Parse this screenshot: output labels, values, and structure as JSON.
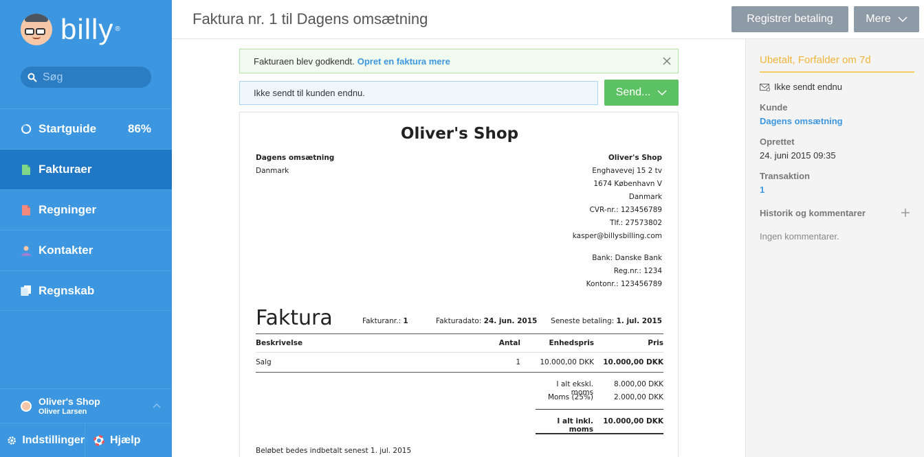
{
  "sidebar": {
    "logo_text": "billy",
    "logo_reg": "®",
    "search_placeholder": "Søg",
    "items": [
      {
        "label": "Startguide",
        "badge": "86%"
      },
      {
        "label": "Fakturaer"
      },
      {
        "label": "Regninger"
      },
      {
        "label": "Kontakter"
      },
      {
        "label": "Regnskab"
      }
    ],
    "user": {
      "org": "Oliver's Shop",
      "name": "Oliver Larsen"
    },
    "settings_label": "Indstillinger",
    "help_label": "Hjælp"
  },
  "topbar": {
    "title": "Faktura nr. 1 til Dagens omsætning",
    "register_label": "Registrer betaling",
    "more_label": "Mere"
  },
  "alerts": {
    "success_text": "Fakturaen blev godkendt.",
    "success_link": "Opret en faktura mere",
    "info_text": "Ikke sendt til kunden endnu.",
    "send_label": "Send..."
  },
  "invoice": {
    "shop_name": "Oliver's Shop",
    "to": {
      "name": "Dagens omsætning",
      "country": "Danmark"
    },
    "from": {
      "name": "Oliver's Shop",
      "street": "Enghavevej 15 2 tv",
      "city": "1674 København V",
      "country": "Danmark",
      "cvr": "CVR-nr.: 123456789",
      "phone": "Tlf.: 27573802",
      "email": "kasper@billysbilling.com"
    },
    "bank": {
      "bank": "Bank: Danske Bank",
      "reg": "Reg.nr.: 1234",
      "account": "Kontonr.: 123456789"
    },
    "heading": "Faktura",
    "meta": {
      "number_label": "Fakturanr.:",
      "number": "1",
      "date_label": "Fakturadato:",
      "date": "24. jun. 2015",
      "due_label": "Seneste betaling:",
      "due": "1. jul. 2015"
    },
    "columns": {
      "desc": "Beskrivelse",
      "qty": "Antal",
      "unit": "Enhedspris",
      "price": "Pris"
    },
    "lines": [
      {
        "desc": "Salg",
        "qty": "1",
        "unit": "10.000,00 DKK",
        "price": "10.000,00 DKK"
      }
    ],
    "totals": {
      "excl_label": "I alt ekskl. moms",
      "excl": "8.000,00 DKK",
      "vat_label": "Moms (25%)",
      "vat": "2.000,00 DKK",
      "incl_label": "I alt inkl. moms",
      "incl": "10.000,00 DKK"
    },
    "note": "Beløbet bedes indbetalt senest 1. jul. 2015"
  },
  "panel": {
    "status": "Ubetalt, Forfalder om 7d",
    "sent_status": "Ikke sendt endnu",
    "customer_label": "Kunde",
    "customer": "Dagens omsætning",
    "created_label": "Oprettet",
    "created": "24. juni 2015 09:35",
    "transaction_label": "Transaktion",
    "transaction": "1",
    "history_label": "Historik og kommentarer",
    "no_comments": "Ingen kommentarer."
  },
  "colors": {
    "sidebar": "#3d97e0",
    "sidebar_active": "#1f77c6",
    "send": "#5cc263",
    "status": "#f0b43a",
    "link": "#3d97e0"
  }
}
